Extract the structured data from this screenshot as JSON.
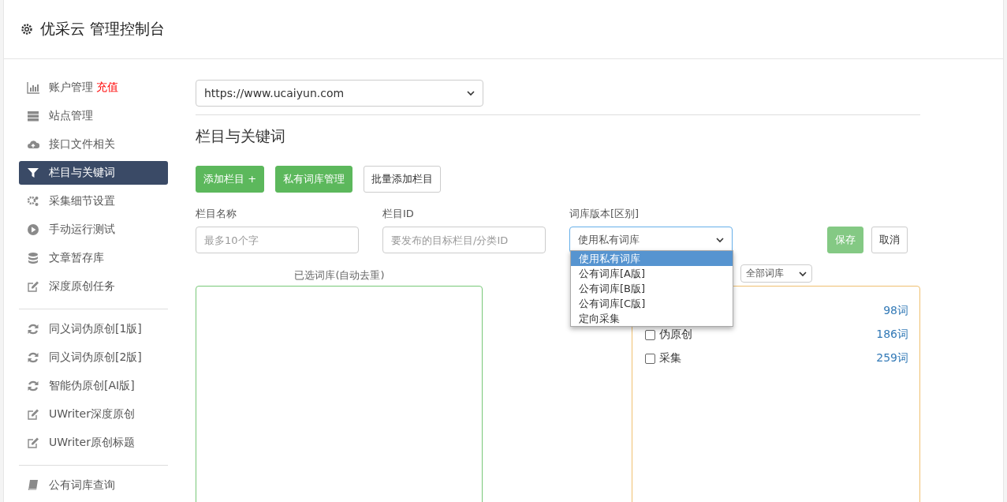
{
  "header": {
    "title": "优采云 管理控制台"
  },
  "sidebar": {
    "groups": [
      [
        {
          "label": "账户管理",
          "badge": "充值",
          "selected": false
        },
        {
          "label": "站点管理",
          "selected": false
        },
        {
          "label": "接口文件相关",
          "selected": false
        },
        {
          "label": "栏目与关键词",
          "selected": true
        },
        {
          "label": "采集细节设置",
          "selected": false
        },
        {
          "label": "手动运行测试",
          "selected": false
        },
        {
          "label": "文章暂存库",
          "selected": false
        },
        {
          "label": "深度原创任务",
          "selected": false
        }
      ],
      [
        {
          "label": "同义词伪原创[1版]",
          "selected": false
        },
        {
          "label": "同义词伪原创[2版]",
          "selected": false
        },
        {
          "label": "智能伪原创[AI版]",
          "selected": false
        },
        {
          "label": "UWriter深度原创",
          "selected": false
        },
        {
          "label": "UWriter原创标题",
          "selected": false
        }
      ],
      [
        {
          "label": "公有词库查询",
          "selected": false
        }
      ]
    ]
  },
  "site_select": {
    "value": "https://www.ucaiyun.com"
  },
  "section_title": "栏目与关键词",
  "buttons": [
    {
      "label": "添加栏目 +",
      "kind": "success"
    },
    {
      "label": "私有词库管理",
      "kind": "success"
    },
    {
      "label": "批量添加栏目",
      "kind": "default"
    }
  ],
  "form": {
    "name_label": "栏目名称",
    "name_placeholder": "最多10个字",
    "id_label": "栏目ID",
    "id_placeholder": "要发布的目标栏目/分类ID",
    "lib_label": "词库版本[区别]",
    "lib_value": "使用私有词库",
    "save": "保存",
    "cancel": "取消"
  },
  "lib_options": [
    {
      "label": "使用私有词库",
      "selected": true
    },
    {
      "label": "公有词库[A版]",
      "selected": false
    },
    {
      "label": "公有词库[B版]",
      "selected": false
    },
    {
      "label": "公有词库[C版]",
      "selected": false
    },
    {
      "label": "定向采集",
      "selected": false
    }
  ],
  "selected_label": "已选词库(自动去重)",
  "filter_select": {
    "value": "全部词库"
  },
  "libraries": [
    {
      "count": "98词"
    },
    {
      "label": "伪原创",
      "count": "186词",
      "checked": false
    },
    {
      "label": "采集",
      "count": "259词",
      "checked": false
    }
  ]
}
